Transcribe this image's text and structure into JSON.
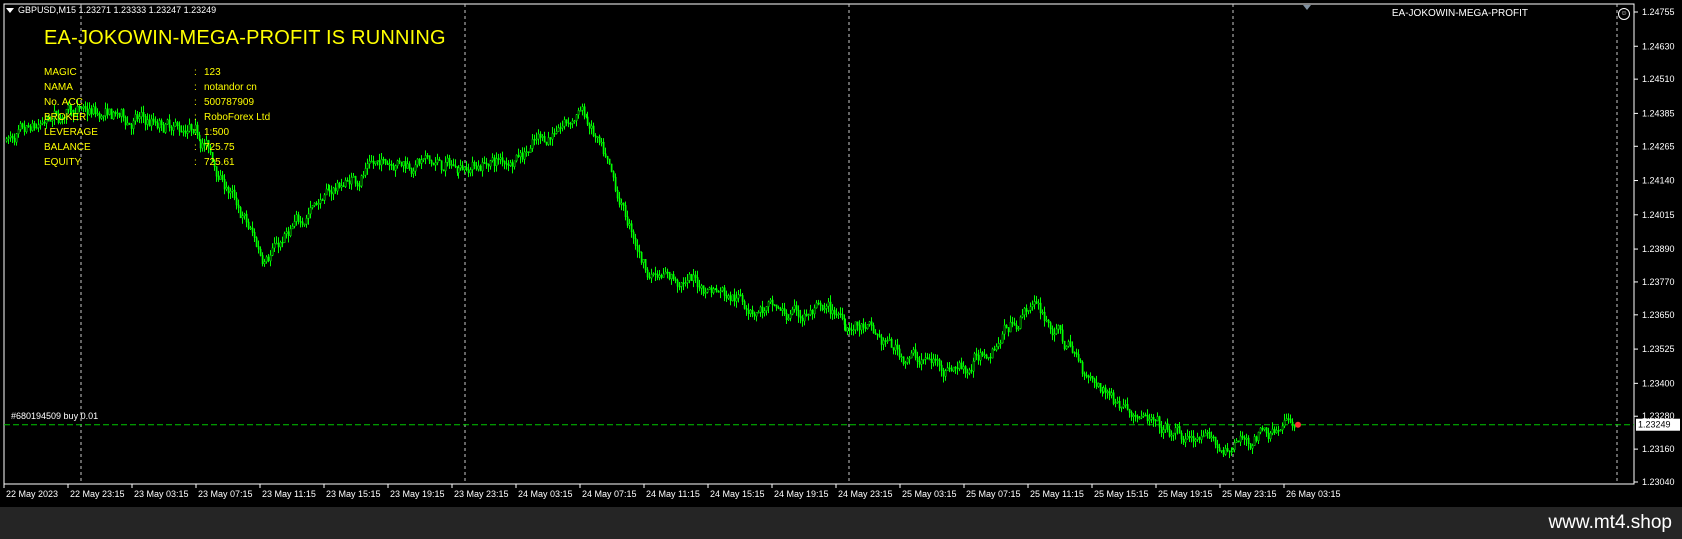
{
  "header": {
    "symbol_line": "GBPUSD,M15  1.23271 1.23333 1.23247 1.23249"
  },
  "expert": {
    "name": "EA-JOKOWIN-MEGA-PROFIT",
    "status_text": "EA-JOKOWIN-MEGA-PROFIT IS RUNNING",
    "info": [
      {
        "label": "MAGIC",
        "value": "123"
      },
      {
        "label": "NAMA",
        "value": "notandor cn"
      },
      {
        "label": "No. ACC",
        "value": "500787909"
      },
      {
        "label": "BROKER",
        "value": "RoboForex Ltd"
      },
      {
        "label": "LEVERAGE",
        "value": "1:500"
      },
      {
        "label": "BALANCE",
        "value": "725.75"
      },
      {
        "label": "EQUITY",
        "value": "725.61"
      }
    ]
  },
  "order": {
    "label": "#680194509 buy 0.01",
    "price": 1.23249
  },
  "price_axis": {
    "ticks": [
      1.24755,
      1.2463,
      1.2451,
      1.24385,
      1.24265,
      1.2414,
      1.24015,
      1.2389,
      1.2377,
      1.2365,
      1.23525,
      1.234,
      1.2328,
      1.2316,
      1.2304
    ],
    "current_price_label": "1.23249"
  },
  "time_axis": {
    "labels": [
      "22 May 2023",
      "22 May 23:15",
      "23 May 03:15",
      "23 May 07:15",
      "23 May 11:15",
      "23 May 15:15",
      "23 May 19:15",
      "23 May 23:15",
      "24 May 03:15",
      "24 May 07:15",
      "24 May 11:15",
      "24 May 15:15",
      "24 May 19:15",
      "24 May 23:15",
      "25 May 03:15",
      "25 May 07:15",
      "25 May 11:15",
      "25 May 15:15",
      "25 May 19:15",
      "25 May 23:15",
      "26 May 03:15"
    ],
    "day_separators": [
      "22 May 23:15",
      "23 May 23:15",
      "24 May 23:15",
      "25 May 23:15"
    ]
  },
  "colors": {
    "background": "#000000",
    "candle": "#00ff00",
    "text_ea": "#ffff00",
    "grid": "#ffffff",
    "order_line": "#00c800"
  },
  "chart_data": {
    "type": "line",
    "title": "",
    "xlabel": "",
    "ylabel": "",
    "ylim": [
      1.2298,
      1.248
    ],
    "x": [
      "22 May 2023",
      "22 May 23:15",
      "23 May 03:15",
      "23 May 07:15",
      "23 May 11:15",
      "23 May 15:15",
      "23 May 19:15",
      "23 May 23:15",
      "24 May 03:15",
      "24 May 07:15",
      "24 May 11:15",
      "24 May 15:15",
      "24 May 19:15",
      "24 May 23:15",
      "25 May 03:15",
      "25 May 07:15",
      "25 May 11:15",
      "25 May 15:15",
      "25 May 19:15",
      "25 May 23:15",
      "26 May 03:15"
    ],
    "series": [
      {
        "values": [
          1.2428,
          1.244,
          1.2436,
          1.2432,
          1.2385,
          1.241,
          1.2422,
          1.2419,
          1.2423,
          1.244,
          1.238,
          1.2375,
          1.2365,
          1.2365,
          1.235,
          1.2345,
          1.237,
          1.234,
          1.2322,
          1.2316,
          1.2325
        ]
      }
    ]
  }
}
